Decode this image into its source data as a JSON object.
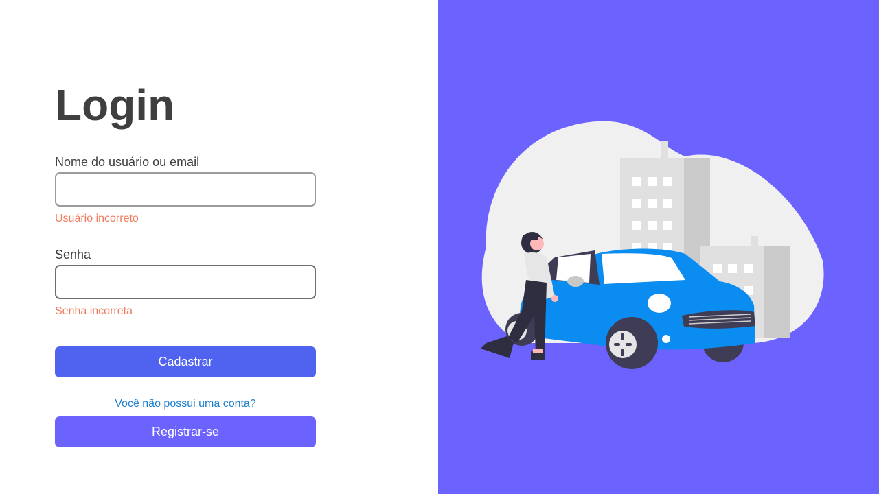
{
  "login": {
    "title": "Login",
    "username": {
      "label": "Nome do usuário ou email",
      "value": "",
      "placeholder": "",
      "error": "Usuário incorreto"
    },
    "password": {
      "label": "Senha",
      "value": "",
      "placeholder": "",
      "error": "Senha incorreta"
    },
    "submit_label": "Cadastrar",
    "no_account_link": "Você não possui uma conta?",
    "register_label": "Registrar-se"
  },
  "colors": {
    "accent_purple": "#6c63ff",
    "button_blue": "#4f63f0",
    "error": "#f07a5c",
    "link": "#1a7fcf",
    "text_dark": "#3f3f3f",
    "car_blue": "#0a8cf0"
  },
  "illustration": {
    "icon": "woman-with-car-illustration"
  }
}
